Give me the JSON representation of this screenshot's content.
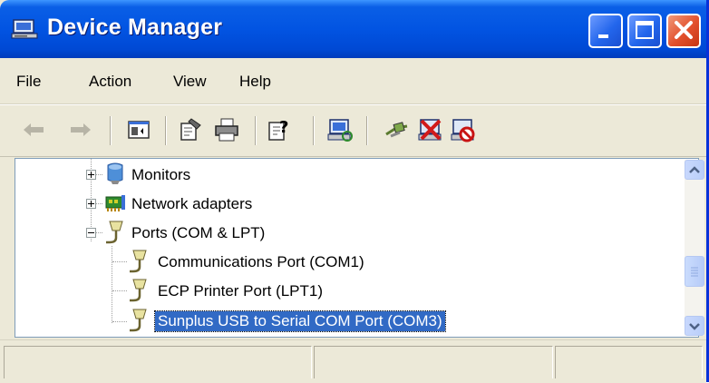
{
  "window": {
    "title": "Device Manager"
  },
  "titlebar_buttons": [
    "minimize",
    "maximize",
    "close"
  ],
  "menu": {
    "items": [
      "File",
      "Action",
      "View",
      "Help"
    ]
  },
  "toolbar": {
    "icons": [
      "back-arrow-icon",
      "forward-arrow-icon",
      "show-hide-tree-icon",
      "properties-icon",
      "print-icon",
      "help-icon",
      "scan-hardware-icon",
      "update-driver-icon",
      "uninstall-icon",
      "disable-icon"
    ]
  },
  "tree": {
    "items": [
      {
        "label": "Monitors",
        "level": 1,
        "expanded": false,
        "icon": "monitor-icon"
      },
      {
        "label": "Network adapters",
        "level": 1,
        "expanded": false,
        "icon": "network-adapter-icon"
      },
      {
        "label": "Ports (COM & LPT)",
        "level": 1,
        "expanded": true,
        "icon": "port-icon"
      },
      {
        "label": "Communications Port (COM1)",
        "level": 2,
        "icon": "port-icon"
      },
      {
        "label": "ECP Printer Port (LPT1)",
        "level": 2,
        "icon": "port-icon"
      },
      {
        "label": "Sunplus USB to Serial COM Port (COM3)",
        "level": 2,
        "icon": "port-icon",
        "selected": true
      }
    ]
  },
  "colors": {
    "titlebar": "#0254e2",
    "selection": "#316ac5",
    "chrome": "#ece9d8",
    "close_button": "#e2502c"
  }
}
